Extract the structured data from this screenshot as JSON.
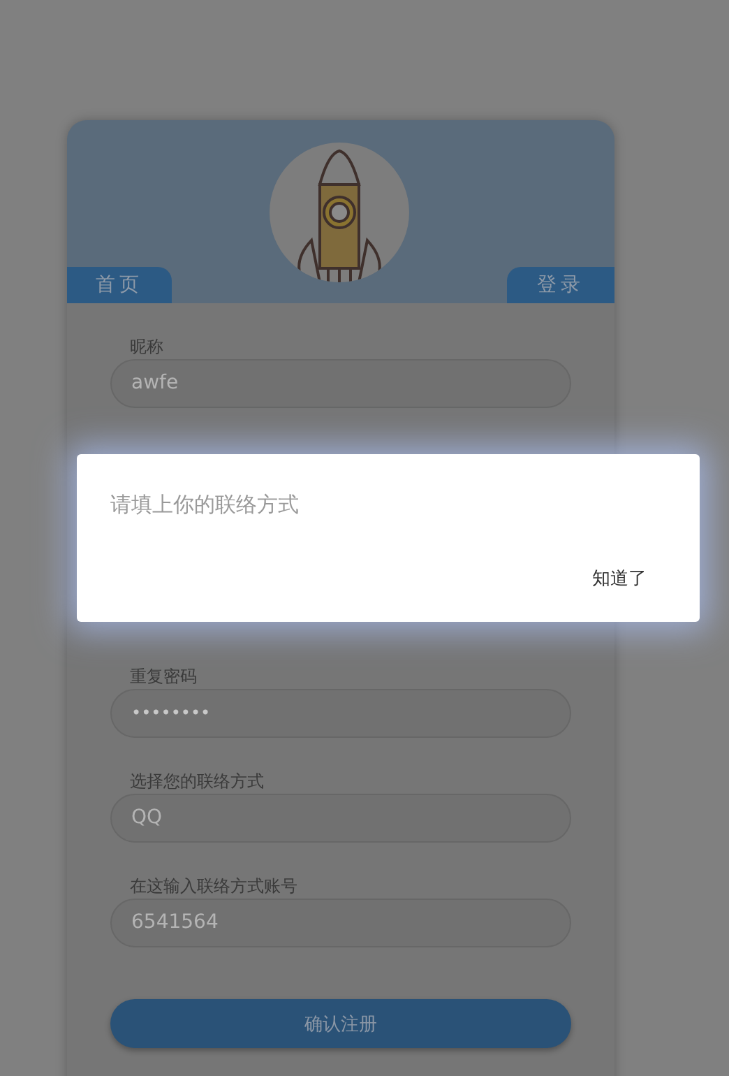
{
  "nav_tabs": [
    {
      "label": "首页",
      "selected": false
    },
    {
      "label": "登录",
      "selected": false
    }
  ],
  "fields": [
    {
      "kind": "text",
      "label": "昵称",
      "value": "awfe"
    },
    {
      "kind": "password",
      "label": "重复密码",
      "value": "••••••••"
    },
    {
      "kind": "text",
      "label": "选择您的联络方式",
      "value": "QQ"
    },
    {
      "kind": "text",
      "label": "在这输入联络方式账号",
      "value": "6541564"
    }
  ],
  "submit_button": "确认注册",
  "dialog": {
    "message": "请填上你的联络方式",
    "button": "知道了"
  }
}
